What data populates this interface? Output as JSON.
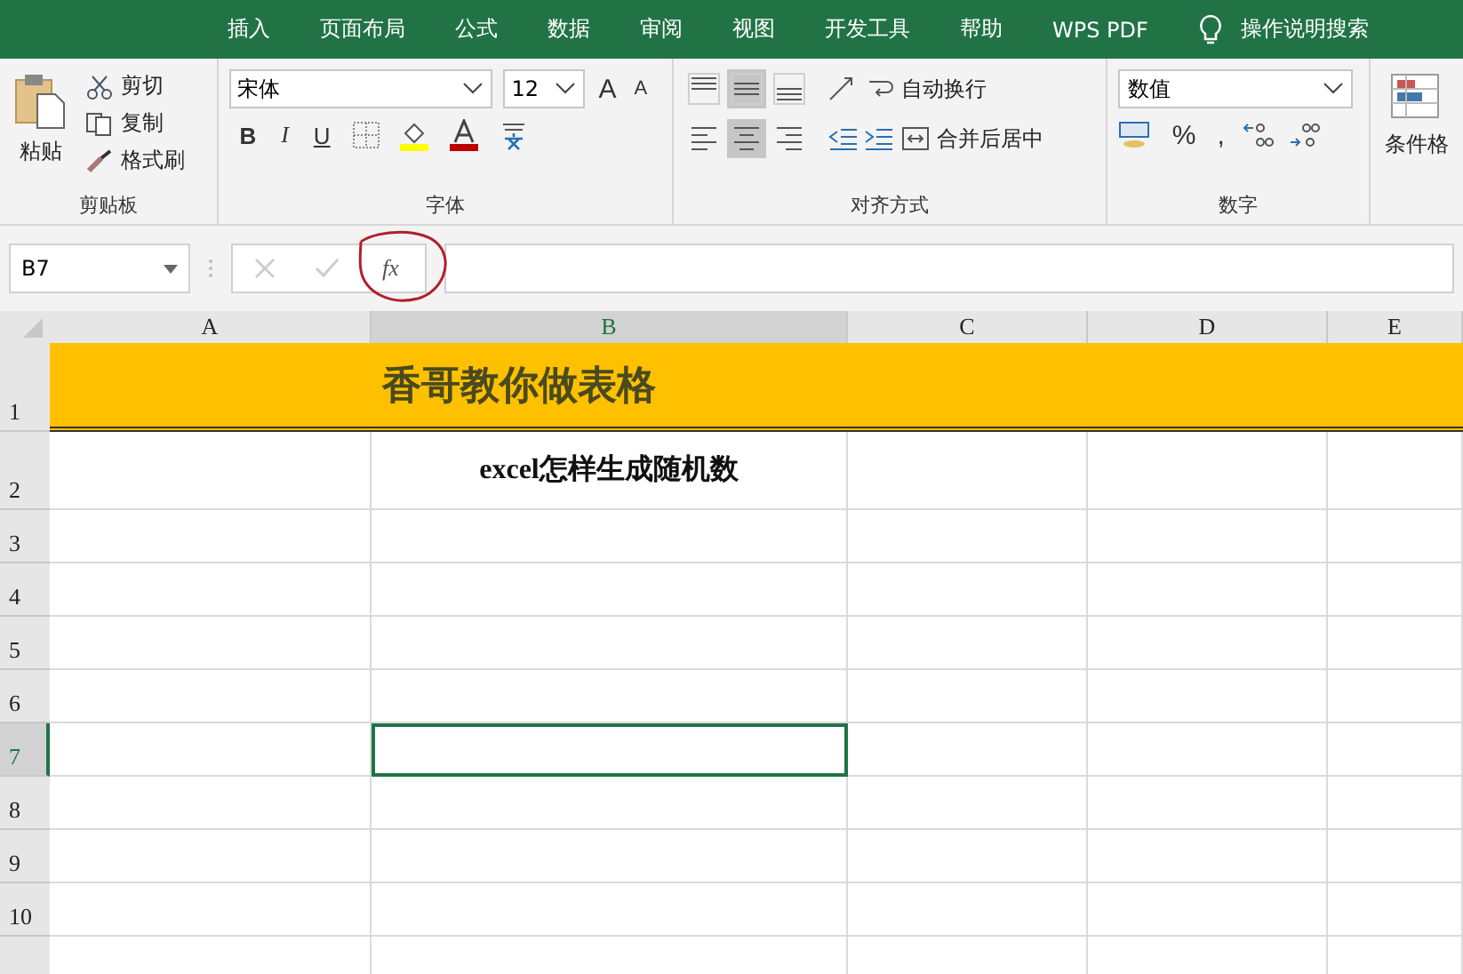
{
  "ribbon_tabs": [
    {
      "label": "插入"
    },
    {
      "label": "页面布局"
    },
    {
      "label": "公式"
    },
    {
      "label": "数据"
    },
    {
      "label": "审阅"
    },
    {
      "label": "视图"
    },
    {
      "label": "开发工具"
    },
    {
      "label": "帮助"
    },
    {
      "label": "WPS PDF"
    }
  ],
  "tell_me": "操作说明搜索",
  "clipboard": {
    "paste": "粘贴",
    "cut": "剪切",
    "copy": "复制",
    "format_painter": "格式刷",
    "label": "剪贴板"
  },
  "font": {
    "name": "宋体",
    "size": "12",
    "grow": "A",
    "shrink": "A",
    "bold": "B",
    "italic": "I",
    "underline": "U",
    "label": "字体"
  },
  "alignment": {
    "vertical": [
      {
        "kind": "top",
        "selected": false
      },
      {
        "kind": "middle",
        "selected": true
      },
      {
        "kind": "bottom",
        "selected": false
      }
    ],
    "horizontal": [
      {
        "kind": "left",
        "selected": false
      },
      {
        "kind": "center",
        "selected": true
      },
      {
        "kind": "right",
        "selected": false
      }
    ],
    "wrap": "自动换行",
    "merge": "合并后居中",
    "label": "对齐方式"
  },
  "number": {
    "format": "数值",
    "percent": "%",
    "comma": ",",
    "label": "数字"
  },
  "styles": {
    "conditional": "条件格"
  },
  "formula_bar": {
    "name_box": "B7",
    "fx": "fx"
  },
  "columns": [
    {
      "label": "A",
      "selected": false
    },
    {
      "label": "B",
      "selected": true
    },
    {
      "label": "C",
      "selected": false
    },
    {
      "label": "D",
      "selected": false
    },
    {
      "label": "E",
      "selected": false
    }
  ],
  "rows": [
    {
      "label": "1",
      "selected": false,
      "kind": "banner",
      "text": "香哥教你做表格"
    },
    {
      "label": "2",
      "selected": false,
      "kind": "subtitle",
      "text": "excel怎样生成随机数"
    },
    {
      "label": "3",
      "selected": false,
      "kind": "empty"
    },
    {
      "label": "4",
      "selected": false,
      "kind": "empty"
    },
    {
      "label": "5",
      "selected": false,
      "kind": "empty"
    },
    {
      "label": "6",
      "selected": false,
      "kind": "empty"
    },
    {
      "label": "7",
      "selected": true,
      "kind": "empty"
    },
    {
      "label": "8",
      "selected": false,
      "kind": "empty"
    },
    {
      "label": "9",
      "selected": false,
      "kind": "empty"
    },
    {
      "label": "10",
      "selected": false,
      "kind": "empty"
    }
  ]
}
